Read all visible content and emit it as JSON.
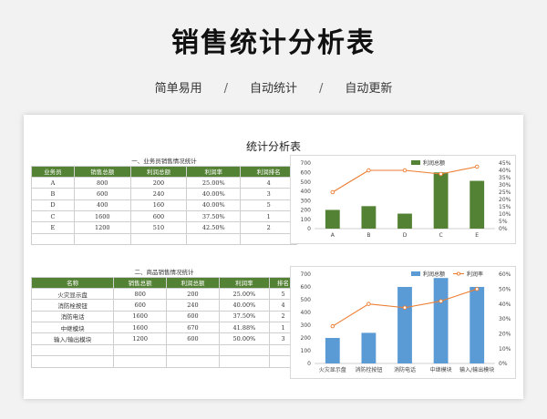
{
  "header": {
    "title": "销售统计分析表",
    "features": [
      "简单易用",
      "自动统计",
      "自动更新"
    ],
    "separator": "/"
  },
  "sheet": {
    "title": "统计分析表",
    "table1": {
      "caption": "一、业务员销售情况统计",
      "headers": [
        "业务员",
        "销售总额",
        "利润总额",
        "利润率",
        "利润排名"
      ],
      "rows": [
        [
          "A",
          "800",
          "200",
          "25.00%",
          "4"
        ],
        [
          "B",
          "600",
          "240",
          "40.00%",
          "3"
        ],
        [
          "D",
          "400",
          "160",
          "40.00%",
          "5"
        ],
        [
          "C",
          "1600",
          "600",
          "37.50%",
          "1"
        ],
        [
          "E",
          "1200",
          "510",
          "42.50%",
          "2"
        ],
        [
          "",
          "",
          "",
          "",
          ""
        ]
      ]
    },
    "table2": {
      "caption": "二、商品销售情况统计",
      "headers": [
        "名称",
        "销售总额",
        "利润总额",
        "利润率",
        "排名"
      ],
      "rows": [
        [
          "火灾显示盘",
          "800",
          "200",
          "25.00%",
          "5"
        ],
        [
          "消防栓按钮",
          "600",
          "240",
          "40.00%",
          "4"
        ],
        [
          "消防电话",
          "1600",
          "600",
          "37.50%",
          "2"
        ],
        [
          "中继模块",
          "1600",
          "670",
          "41.88%",
          "1"
        ],
        [
          "输入/输出模块",
          "1200",
          "600",
          "50.00%",
          "3"
        ],
        [
          "",
          "",
          "",
          "",
          ""
        ],
        [
          "",
          "",
          "",
          "",
          ""
        ]
      ]
    }
  },
  "chart_data": [
    {
      "type": "bar",
      "categories": [
        "A",
        "B",
        "D",
        "C",
        "E"
      ],
      "series": [
        {
          "name": "利润总额",
          "type": "bar",
          "axis": "left",
          "values": [
            200,
            240,
            160,
            600,
            510
          ],
          "color": "#548235"
        },
        {
          "name": "",
          "type": "line",
          "axis": "right",
          "values": [
            0.25,
            0.4,
            0.4,
            0.375,
            0.425
          ],
          "color": "#ed7d31"
        }
      ],
      "left_axis": {
        "ylim": [
          0,
          700
        ],
        "ticks": [
          "0",
          "100",
          "200",
          "300",
          "400",
          "500",
          "600",
          "700"
        ]
      },
      "right_axis": {
        "ylim": [
          0,
          0.45
        ],
        "ticks": [
          "0%",
          "5%",
          "10%",
          "15%",
          "20%",
          "25%",
          "30%",
          "35%",
          "40%",
          "45%"
        ]
      },
      "legend": "top-right",
      "grid": false
    },
    {
      "type": "bar",
      "categories": [
        "火灾显示盘",
        "消防栓按钮",
        "消防电话",
        "中继模块",
        "输入/输出模块"
      ],
      "series": [
        {
          "name": "利润总额",
          "type": "bar",
          "axis": "left",
          "values": [
            200,
            240,
            600,
            670,
            600
          ],
          "color": "#5b9bd5"
        },
        {
          "name": "利润率",
          "type": "line",
          "axis": "right",
          "values": [
            0.25,
            0.4,
            0.375,
            0.4188,
            0.5
          ],
          "color": "#ed7d31"
        }
      ],
      "left_axis": {
        "ylim": [
          0,
          700
        ],
        "ticks": [
          "0",
          "100",
          "200",
          "300",
          "400",
          "500",
          "600",
          "700"
        ]
      },
      "right_axis": {
        "ylim": [
          0,
          0.6
        ],
        "ticks": [
          "0%",
          "10%",
          "20%",
          "30%",
          "40%",
          "50%",
          "60%"
        ]
      },
      "legend": "top-right",
      "grid": false
    }
  ]
}
